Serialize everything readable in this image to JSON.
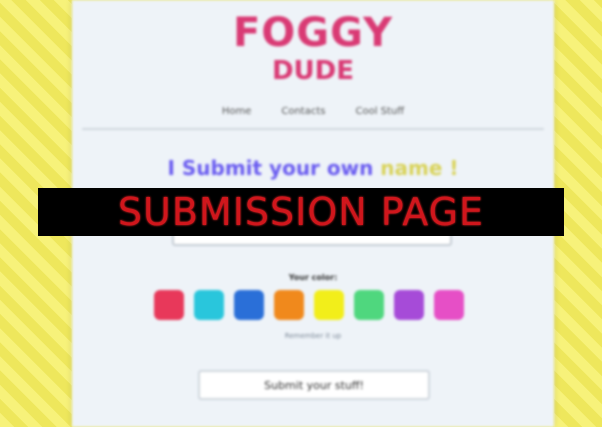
{
  "site": {
    "logo_top": "FOGGY",
    "logo_bottom": "DUDE"
  },
  "nav": {
    "items": [
      "Home",
      "Contacts",
      "Cool Stuff"
    ]
  },
  "form": {
    "heading_main": "I Submit your own ",
    "heading_tail": "name !",
    "name_value": "",
    "color_label": "Your color:",
    "hint": "Remember it up",
    "submit_label": "Submit your stuff!"
  },
  "swatches": [
    {
      "name": "red",
      "color": "#e8385a"
    },
    {
      "name": "cyan",
      "color": "#29c6dc"
    },
    {
      "name": "blue",
      "color": "#2a6fd8"
    },
    {
      "name": "orange",
      "color": "#f0891c"
    },
    {
      "name": "yellow",
      "color": "#f2ee1a"
    },
    {
      "name": "green",
      "color": "#4fd77e"
    },
    {
      "name": "purple",
      "color": "#a64bd8"
    },
    {
      "name": "pink",
      "color": "#e64fc6"
    }
  ],
  "banner": {
    "text": "SUBMISSION PAGE"
  }
}
